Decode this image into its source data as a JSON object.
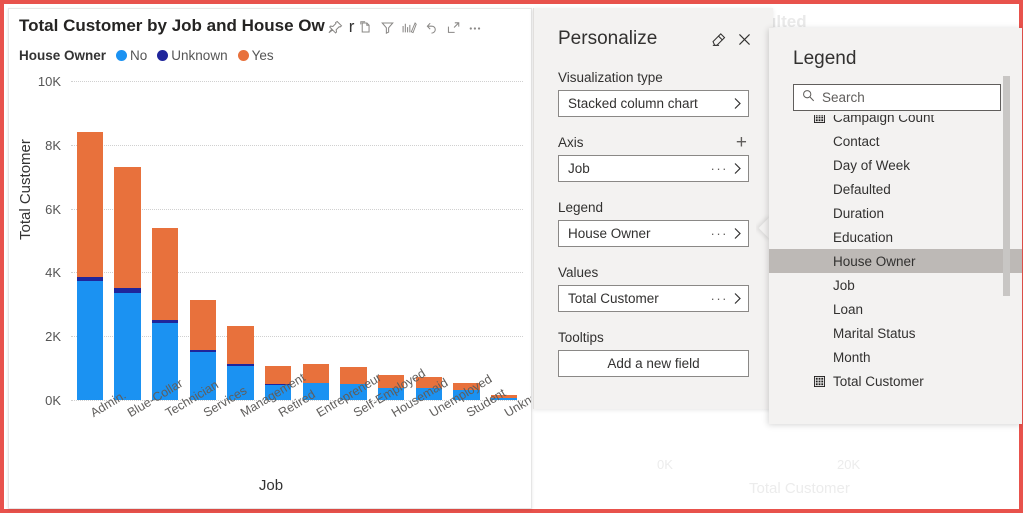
{
  "theme": {
    "border_color": "#e8524c",
    "series_colors": {
      "no": "#1b92f2",
      "unknown": "#1f259b",
      "yes": "#e8713c"
    },
    "selection_color": "#bdb9b6"
  },
  "background_report": {
    "faded_title": "ulted",
    "x_ticks": [
      "0K",
      "20K"
    ],
    "x_axis_title": "Total Customer"
  },
  "visual": {
    "title": "Total Customer by Job and House Ow",
    "title_cut": "r",
    "header_icons": [
      {
        "name": "pin-icon",
        "label": "Pin to dashboard"
      },
      {
        "name": "copy-icon",
        "label": "Copy visual"
      },
      {
        "name": "filter-icon",
        "label": "Filters"
      },
      {
        "name": "drill-icon",
        "label": "Drill"
      },
      {
        "name": "reset-icon",
        "label": "Reset"
      },
      {
        "name": "focus-mode-icon",
        "label": "Focus mode"
      },
      {
        "name": "more-options-icon",
        "label": "More options"
      }
    ],
    "legend": {
      "title": "House Owner",
      "items": [
        {
          "label": "No",
          "color": "#1b92f2"
        },
        {
          "label": "Unknown",
          "color": "#1f259b"
        },
        {
          "label": "Yes",
          "color": "#e8713c"
        }
      ]
    }
  },
  "chart_data": {
    "type": "bar",
    "subtype": "stacked-column",
    "title": "Total Customer by Job and House Ow",
    "xlabel": "Job",
    "ylabel": "Total Customer",
    "ylim": [
      0,
      10000
    ],
    "yticks": [
      "0K",
      "2K",
      "4K",
      "6K",
      "8K",
      "10K"
    ],
    "ytick_values": [
      0,
      2000,
      4000,
      6000,
      8000,
      10000
    ],
    "grid": true,
    "legend_position": "top",
    "legend_title": "House Owner",
    "categories": [
      "Admin.",
      "Blue-Collar",
      "Technician",
      "Services",
      "Management",
      "Retired",
      "Entrepreneur",
      "Self-Employed",
      "Housemaid",
      "Unemployed",
      "Student",
      "Unknown"
    ],
    "series": [
      {
        "name": "No",
        "color": "#1b92f2",
        "values": [
          3730,
          3370,
          2420,
          1510,
          1070,
          480,
          520,
          500,
          370,
          380,
          300,
          50
        ]
      },
      {
        "name": "Unknown",
        "color": "#1f259b",
        "values": [
          130,
          140,
          90,
          70,
          60,
          10,
          10,
          10,
          10,
          10,
          10,
          0
        ]
      },
      {
        "name": "Yes",
        "color": "#e8713c",
        "values": [
          4540,
          3800,
          2890,
          1560,
          1180,
          590,
          590,
          540,
          420,
          330,
          230,
          110
        ]
      }
    ],
    "totals": [
      8400,
      7310,
      5400,
      3140,
      2310,
      1080,
      1120,
      1050,
      800,
      720,
      540,
      160
    ]
  },
  "personalize": {
    "title": "Personalize",
    "reset_icon": "eraser-icon",
    "close_icon": "close-icon",
    "sections": [
      {
        "label": "Visualization type",
        "value": "Stacked column chart",
        "has_add": false,
        "has_dots": false
      },
      {
        "label": "Axis",
        "value": "Job",
        "has_add": true,
        "has_dots": true
      },
      {
        "label": "Legend",
        "value": "House Owner",
        "has_add": false,
        "has_dots": true
      },
      {
        "label": "Values",
        "value": "Total Customer",
        "has_add": false,
        "has_dots": true
      }
    ],
    "tooltips_label": "Tooltips",
    "tooltips_button": "Add a new field"
  },
  "legend_flyout": {
    "title": "Legend",
    "search": {
      "placeholder": "Search",
      "value": "",
      "icon": "search-icon"
    },
    "items": [
      {
        "label": "Campaign Count",
        "icon": "measure-icon",
        "selected": false
      },
      {
        "label": "Contact",
        "icon": "",
        "selected": false
      },
      {
        "label": "Day of Week",
        "icon": "",
        "selected": false
      },
      {
        "label": "Defaulted",
        "icon": "",
        "selected": false
      },
      {
        "label": "Duration",
        "icon": "",
        "selected": false
      },
      {
        "label": "Education",
        "icon": "",
        "selected": false
      },
      {
        "label": "House Owner",
        "icon": "",
        "selected": true
      },
      {
        "label": "Job",
        "icon": "",
        "selected": false
      },
      {
        "label": "Loan",
        "icon": "",
        "selected": false
      },
      {
        "label": "Marital Status",
        "icon": "",
        "selected": false
      },
      {
        "label": "Month",
        "icon": "",
        "selected": false
      },
      {
        "label": "Total Customer",
        "icon": "measure-icon",
        "selected": false
      }
    ]
  }
}
